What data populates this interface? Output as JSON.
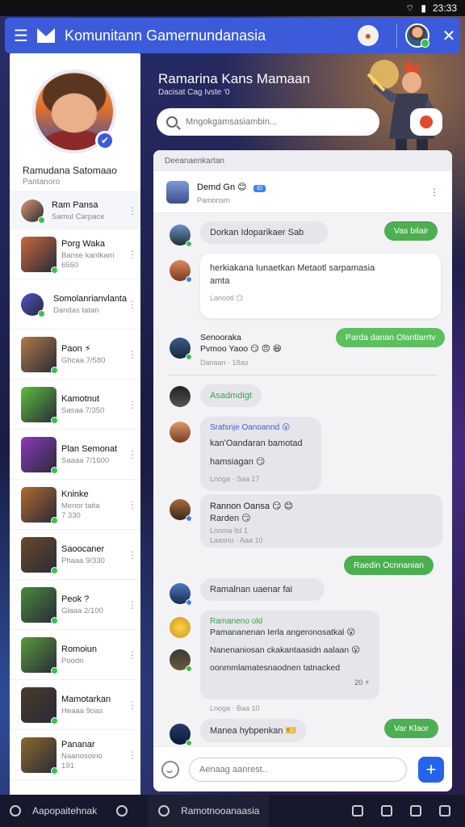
{
  "statusbar": {
    "time": "23:33",
    "wifi_icon": "wifi-icon",
    "battery_icon": "battery-icon"
  },
  "appbar": {
    "title": "Komunitann Gamernundanasia"
  },
  "profile": {
    "name": "Ramudana Satomaao",
    "subtitle": "Pantanoro"
  },
  "conversations": [
    {
      "name": "Ram Pansa",
      "preview": "Samul Carpace",
      "preview2": "",
      "color": "#d99a6c",
      "round": false
    },
    {
      "name": "Porg Waka",
      "preview": "Banse kantkam",
      "preview2": "6560",
      "color": "#c66a3b",
      "round": false
    },
    {
      "name": "Somolanrianvlanta",
      "preview": "Dandas tatan",
      "preview2": "",
      "color": "#4b55c8",
      "round": true
    },
    {
      "name": "Paon ⚡",
      "preview": "Ghcaa 7/580",
      "preview2": "",
      "color": "#b07a45",
      "round": false
    },
    {
      "name": "Kamotnut",
      "preview": "Sasaa 7/350",
      "preview2": "",
      "color": "#5bbf3b",
      "round": false
    },
    {
      "name": "Plan Semonat",
      "preview": "Saaaa 7/1600",
      "preview2": "",
      "color": "#8a3ab8",
      "round": false
    },
    {
      "name": "Kninke",
      "preview": "Menor taita",
      "preview2": "7 330",
      "color": "#b06a2a",
      "round": false
    },
    {
      "name": "Saoocaner",
      "preview": "Phaaa 9/330",
      "preview2": "",
      "color": "#6a4a2a",
      "round": false
    },
    {
      "name": "Peok ?",
      "preview": "Glaaa 2/100",
      "preview2": "",
      "color": "#4a8a3a",
      "round": false
    },
    {
      "name": "Romoiun",
      "preview": "Poodn",
      "preview2": "",
      "color": "#5a9a3a",
      "round": false
    },
    {
      "name": "Mamotarkan",
      "preview": "Heaaa 9oas",
      "preview2": "",
      "color": "#4a3a2a",
      "round": false
    },
    {
      "name": "Pananar",
      "preview": "Naanosoino",
      "preview2": "191",
      "color": "#8a6a2a",
      "round": false
    }
  ],
  "hero": {
    "title": "Ramarina Kans Mamaan",
    "subtitle": "Dacisat Cag Ivste '0"
  },
  "search": {
    "placeholder": "Mngokgamsasiambin..."
  },
  "chat": {
    "section_label": "Deeanaenkartan",
    "head_name": "Demd Gn 😊",
    "head_tag": "ID",
    "head_sub": "Pamonsrn",
    "messages": {
      "m1": "Dorkan Idoparikaer Sab",
      "m1_out": "Vas bilair",
      "m2_line1": "herkiakana Iunaetkan Metaotl sarpamasia",
      "m2_line2": "amta",
      "m2_meta": "Lanootl 😏",
      "m3_name": "Senooraka",
      "m3_text": "Pvmoo Yaoo 😏 😠 😆",
      "m3_meta": "Danaan · 18ao",
      "m3_out": "Parda danan Olantlarrtv",
      "m4": "Asadmdigt",
      "m5_name": "Srafsnje Oanoannd 😮",
      "m5_line1": "kan'Oandaran bamotad",
      "m5_line2": "hamsiagan 😏",
      "m5_meta": "Lnoga · Saa 17",
      "m6_name": "Rannon Oansa 😏 😊",
      "m6_line1": "Rarden 😏",
      "m6_meta1": "Lnoma ltd 1",
      "m6_meta2": "Laasnu · Aaa 10",
      "m6_out": "Raedin Ocnnanian",
      "m7": "Ramalnan uaenar fai",
      "m8_name": "Ramaneno old",
      "m8_line1": "Pamananenan Ierla angeronosatkal 😮",
      "m8_line2": "Nanenaniosan ckakantaasidn aalaan 😮",
      "m8_line3": "oonmmlamatesnaodnen tatnacked",
      "m8_count": "20 ⚡",
      "m8_meta": "Lnoga · Baa 10",
      "m9": "Manea hybpenkan 🎫",
      "m9_out": "Var Klaor"
    },
    "composer_placeholder": "Aenaag aanrest.."
  },
  "bottombar": {
    "left_label": "Aapopaitehnak",
    "mid_label": "Ramotnooanaasia"
  },
  "colors": {
    "accent": "#3b5bdb",
    "out_bubble": "#4caf50",
    "online": "#35c24a"
  }
}
